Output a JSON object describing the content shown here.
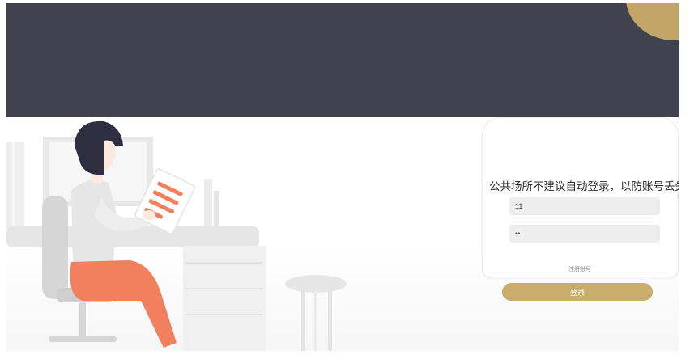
{
  "login": {
    "title": "公共场所不建议自动登录，以防账号丢失",
    "username_value": "11",
    "password_value": "11",
    "register_label": "注册账号",
    "submit_label": "登录"
  },
  "colors": {
    "header_band": "#40434d",
    "accent_gold": "#c3a667",
    "button_gold": "#c9ad6c",
    "field_bg": "#eeeeee",
    "pants": "#f27f5e",
    "hair": "#2f2e41",
    "paper_lines": "#f27f5e"
  },
  "icons": {
    "cursor": "mouse-pointer-icon",
    "card_edge_arrow": "chevron-right-icon"
  }
}
